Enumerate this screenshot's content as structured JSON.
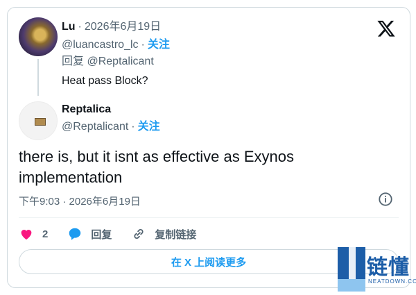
{
  "parent": {
    "name": "Lu",
    "date": "2026年6月19日",
    "handle": "@luancastro_lc",
    "follow": "关注",
    "reply_prefix": "回复",
    "reply_to": "@Reptalicant",
    "text": "Heat pass Block?"
  },
  "reply": {
    "name": "Reptalica",
    "handle": "@Reptalicant",
    "follow": "关注",
    "text": "there is, but it isnt as effective as Exynos implementation",
    "time": "下午9:03 · 2026年6月19日"
  },
  "actions": {
    "like_count": "2",
    "reply_label": "回复",
    "copy_label": "复制链接"
  },
  "read_more": "在 X 上阅读更多",
  "watermark": {
    "cn": "链懂",
    "en": "NEATDOWN.COM"
  },
  "colors": {
    "accent": "#1d9bf0",
    "like": "#f91880",
    "muted": "#536471"
  },
  "icons": [
    "x-logo-icon",
    "info-icon",
    "heart-icon",
    "reply-bubble-icon",
    "link-icon"
  ]
}
